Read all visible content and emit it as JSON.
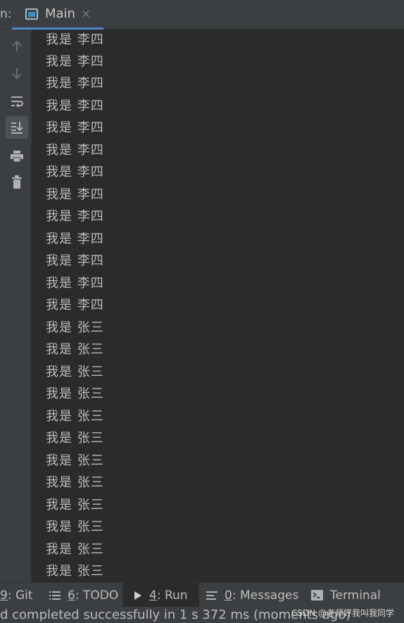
{
  "header": {
    "run_label": "n:",
    "tab_title": "Main",
    "tab_close": "×"
  },
  "console": {
    "lines": [
      "我是 李四",
      "我是 李四",
      "我是 李四",
      "我是 李四",
      "我是 李四",
      "我是 李四",
      "我是 李四",
      "我是 李四",
      "我是 李四",
      "我是 李四",
      "我是 李四",
      "我是 李四",
      "我是 李四",
      "我是 张三",
      "我是 张三",
      "我是 张三",
      "我是 张三",
      "我是 张三",
      "我是 张三",
      "我是 张三",
      "我是 张三",
      "我是 张三",
      "我是 张三",
      "我是 张三",
      "我是 张三"
    ]
  },
  "bottom_tabs": {
    "git": {
      "num": "9",
      "label": ": Git"
    },
    "todo": {
      "num": "6",
      "label": ": TODO"
    },
    "run": {
      "num": "4",
      "label": ": Run"
    },
    "messages": {
      "num": "0",
      "label": ": Messages"
    },
    "terminal": {
      "label": "Terminal"
    }
  },
  "status": {
    "text": "d completed successfully in 1 s 372 ms (moments ago)",
    "watermark": "CSDN @老师好我叫我同学"
  },
  "colors": {
    "accent": "#4a88c7",
    "background": "#2b2b2b",
    "panel": "#3c3f41"
  }
}
